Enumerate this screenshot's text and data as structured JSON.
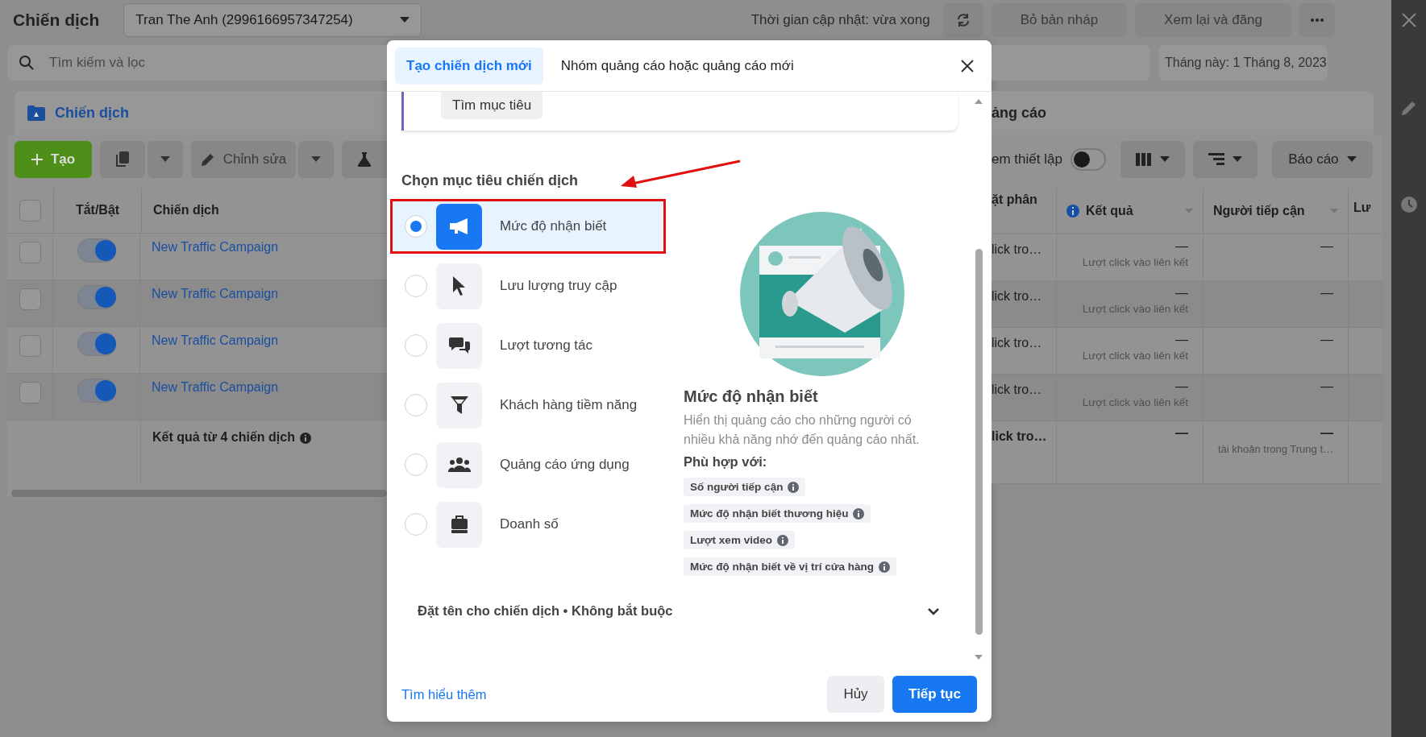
{
  "top_bar": {
    "title": "Chiến dịch",
    "account": "Tran The Anh (2996166957347254)",
    "update_status": "Thời gian cập nhật: vừa xong",
    "buttons": [
      "Bỏ bản nháp",
      "Xem lại và đăng"
    ]
  },
  "search": {
    "placeholder": "Tìm kiếm và lọc"
  },
  "date_range": "Tháng này: 1 Tháng 8, 2023",
  "tabs": [
    {
      "label": "Chiến dịch",
      "selected": true
    },
    {
      "label": "ảng cáo",
      "selected": false
    }
  ],
  "toolbar": {
    "create": "Tạo",
    "edit": "Chỉnh sửa",
    "view_setup": {
      "label": "em thiết lập",
      "on": false
    },
    "report": "Báo cáo"
  },
  "table_left": {
    "select_all_checked": false,
    "columns": [
      "Tắt/Bật",
      "Chiến dịch"
    ],
    "rows": [
      {
        "checked": false,
        "on": true,
        "name": "New Traffic Campaign"
      },
      {
        "checked": false,
        "on": true,
        "name": "New Traffic Campaign"
      },
      {
        "checked": false,
        "on": true,
        "name": "New Traffic Campaign"
      },
      {
        "checked": false,
        "on": true,
        "name": "New Traffic Campaign"
      }
    ],
    "summary": "Kết quả từ 4 chiến dịch"
  },
  "table_right": {
    "columns": [
      "ặt phân",
      "Kết quả",
      "Người tiếp cận",
      "Lư"
    ],
    "rows": [
      {
        "column_1": "lick tro…",
        "result": "—",
        "result_type": "Lượt click vào liên kết",
        "reach": "—"
      },
      {
        "column_1": "lick tro…",
        "result": "—",
        "result_type": "Lượt click vào liên kết",
        "reach": "—"
      },
      {
        "column_1": "lick tro…",
        "result": "—",
        "result_type": "Lượt click vào liên kết",
        "reach": "—"
      },
      {
        "column_1": "lick tro…",
        "result": "—",
        "result_type": "Lượt click vào liên kết",
        "reach": "—"
      }
    ],
    "summary": {
      "column_1": "lick tro…",
      "result": "—",
      "reach": "—",
      "reach_note": "tài khoản trong Trung t…"
    }
  },
  "dialog": {
    "tabs": [
      {
        "label": "Tạo chiến dịch mới",
        "selected": true
      },
      {
        "label": "Nhóm quảng cáo hoặc quảng cáo mới",
        "selected": false
      }
    ],
    "find_goal_button": "Tìm mục tiêu",
    "heading": "Chọn mục tiêu chiến dịch",
    "objectives": [
      {
        "label": "Mức độ nhận biết",
        "selected": true
      },
      {
        "label": "Lưu lượng truy cập",
        "selected": false
      },
      {
        "label": "Lượt tương tác",
        "selected": false
      },
      {
        "label": "Khách hàng tiềm năng",
        "selected": false
      },
      {
        "label": "Quảng cáo ứng dụng",
        "selected": false
      },
      {
        "label": "Doanh số",
        "selected": false
      }
    ],
    "detail": {
      "title": "Mức độ nhận biết",
      "description": "Hiển thị quảng cáo cho những người có nhiều khả năng nhớ đến quảng cáo nhất.",
      "fit_label": "Phù hợp với:",
      "tags": [
        "Số người tiếp cận",
        "Mức độ nhận biết thương hiệu",
        "Lượt xem video",
        "Mức độ nhận biết về vị trí cửa hàng"
      ]
    },
    "name_section": "Đặt tên cho chiến dịch • Không bắt buộc",
    "learn_more": "Tìm hiểu thêm",
    "cancel": "Hủy",
    "continue": "Tiếp tục"
  }
}
